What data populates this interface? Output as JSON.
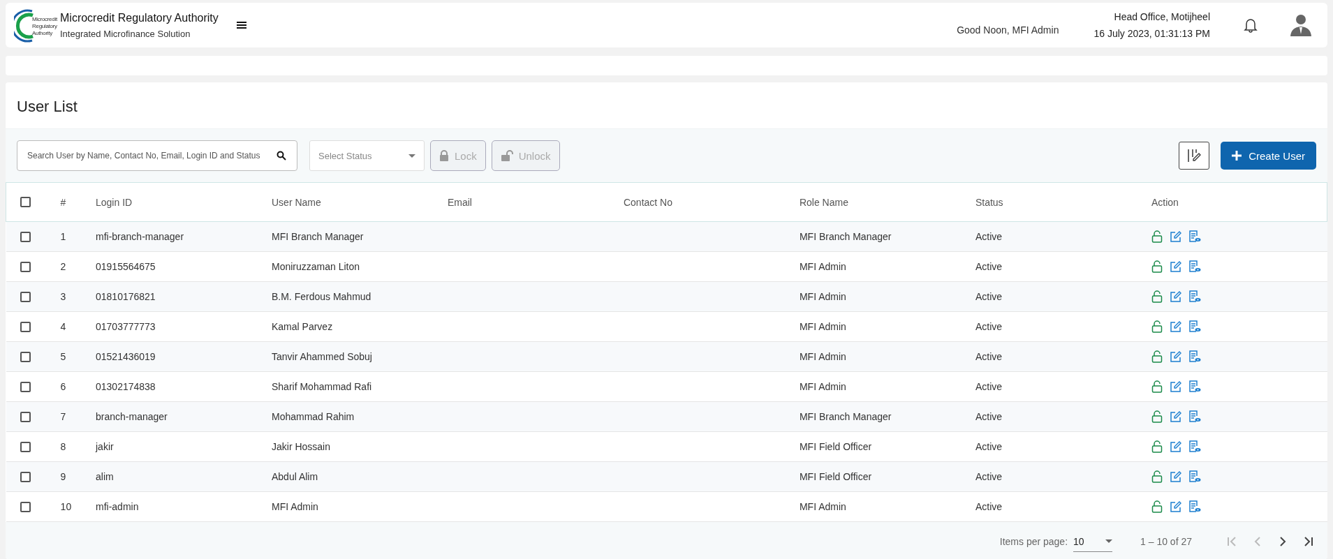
{
  "header": {
    "org_name": "Microcredit Regulatory Authority",
    "app_name": "Integrated Microfinance Solution",
    "logo_text": [
      "Microcredit",
      "Regulatory",
      "Authority"
    ],
    "greeting": "Good Noon, MFI Admin",
    "office": "Head Office, Motijheel",
    "datetime": "16 July 2023, 01:31:13 PM"
  },
  "page_title": "User List",
  "toolbar": {
    "search_placeholder": "Search User by Name, Contact No, Email, Login ID and Status",
    "status_placeholder": "Select Status",
    "lock_label": "Lock",
    "lock_disabled": true,
    "unlock_label": "Unlock",
    "unlock_disabled": true,
    "create_label": "Create User"
  },
  "table": {
    "columns": [
      "#",
      "Login ID",
      "User Name",
      "Email",
      "Contact No",
      "Role Name",
      "Status",
      "Action"
    ],
    "header_checked": false,
    "rows": [
      {
        "no": "1",
        "login_id": "mfi-branch-manager",
        "user_name": "MFI Branch Manager",
        "email": "",
        "contact": "",
        "role": "MFI Branch Manager",
        "status": "Active",
        "checked": false
      },
      {
        "no": "2",
        "login_id": "01915564675",
        "user_name": "Moniruzzaman Liton",
        "email": "",
        "contact": "",
        "role": "MFI Admin",
        "status": "Active",
        "checked": false
      },
      {
        "no": "3",
        "login_id": "01810176821",
        "user_name": "B.M. Ferdous Mahmud",
        "email": "",
        "contact": "",
        "role": "MFI Admin",
        "status": "Active",
        "checked": false
      },
      {
        "no": "4",
        "login_id": "01703777773",
        "user_name": "Kamal Parvez",
        "email": "",
        "contact": "",
        "role": "MFI Admin",
        "status": "Active",
        "checked": false
      },
      {
        "no": "5",
        "login_id": "01521436019",
        "user_name": "Tanvir Ahammed Sobuj",
        "email": "",
        "contact": "",
        "role": "MFI Admin",
        "status": "Active",
        "checked": false
      },
      {
        "no": "6",
        "login_id": "01302174838",
        "user_name": "Sharif Mohammad Rafi",
        "email": "",
        "contact": "",
        "role": "MFI Admin",
        "status": "Active",
        "checked": false
      },
      {
        "no": "7",
        "login_id": "branch-manager",
        "user_name": "Mohammad Rahim",
        "email": "",
        "contact": "",
        "role": "MFI Branch Manager",
        "status": "Active",
        "checked": false
      },
      {
        "no": "8",
        "login_id": "jakir",
        "user_name": "Jakir Hossain",
        "email": "",
        "contact": "",
        "role": "MFI Field Officer",
        "status": "Active",
        "checked": false
      },
      {
        "no": "9",
        "login_id": "alim",
        "user_name": "Abdul Alim",
        "email": "",
        "contact": "",
        "role": "MFI Field Officer",
        "status": "Active",
        "checked": false
      },
      {
        "no": "10",
        "login_id": "mfi-admin",
        "user_name": "MFI Admin",
        "email": "",
        "contact": "",
        "role": "MFI Admin",
        "status": "Active",
        "checked": false
      }
    ]
  },
  "paginator": {
    "items_per_page_label": "Items per page:",
    "page_size": "10",
    "range": "1 – 10 of 27",
    "first_disabled": true,
    "prev_disabled": true,
    "next_disabled": false,
    "last_disabled": false
  }
}
